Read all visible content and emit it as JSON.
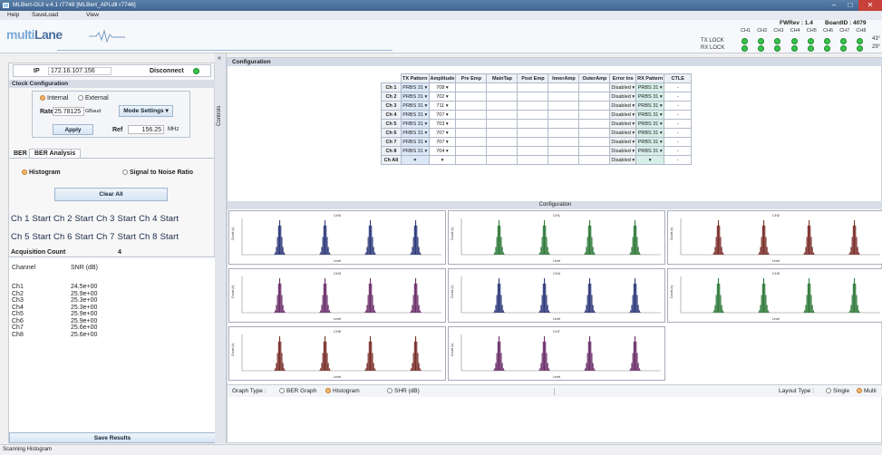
{
  "window": {
    "title": "MLBert-GUI v.4.1 r7748 [MLBert_API.dll r7746]"
  },
  "menu": [
    "Help",
    "SaveLoad",
    "View"
  ],
  "header": {
    "logo_main": "multi",
    "logo_accent": "Lane",
    "fwrev": "FWRev : 1.4",
    "boardid": "BoardID : 4079",
    "tx_lock": "TX LOCK",
    "rx_lock": "RX LOCK",
    "channels": [
      "CH1",
      "CH2",
      "CH3",
      "CH4",
      "CH5",
      "CH6",
      "CH7",
      "CH8"
    ],
    "side_values": [
      "43°",
      "29°"
    ]
  },
  "connection": {
    "ip_label": "IP",
    "ip_value": "172.16.107.156",
    "disconnect_label": "Disconnect"
  },
  "clock": {
    "title": "Clock Configuration",
    "internal": "Internal",
    "external": "External",
    "rate_label": "Rate",
    "rate_value": "25.78125",
    "unit": "GBaud",
    "mode_btn": "Mode Settings",
    "apply": "Apply",
    "ref_label": "Ref",
    "ref_value": "156.25",
    "ref_unit": "MHz"
  },
  "tabs": [
    "BER",
    "BER Analysis"
  ],
  "analysis": {
    "histogram": "Histogram",
    "snr": "Signal to Noise Ratio",
    "clear_all": "Clear All"
  },
  "starts": [
    [
      "Ch 1",
      "Start"
    ],
    [
      "Ch 2",
      "Start"
    ],
    [
      "Ch 3",
      "Start"
    ],
    [
      "Ch 4",
      "Start"
    ],
    [
      "Ch 5",
      "Start"
    ],
    [
      "Ch 6",
      "Start"
    ],
    [
      "Ch 7",
      "Start"
    ],
    [
      "Ch 8",
      "Start"
    ]
  ],
  "acq": {
    "label": "Acquisition Count",
    "value": "4",
    "channel_hdr": "Channel",
    "snr_hdr": "SNR (dB)"
  },
  "snr_rows": [
    [
      "Ch1",
      "24.5e+00"
    ],
    [
      "Ch2",
      "25.9e+00"
    ],
    [
      "Ch3",
      "25.3e+00"
    ],
    [
      "Ch4",
      "25.3e+00"
    ],
    [
      "Ch5",
      "25.9e+00"
    ],
    [
      "Ch6",
      "25.9e+00"
    ],
    [
      "Ch7",
      "25.6e+00"
    ],
    [
      "Ch8",
      "25.6e+00"
    ]
  ],
  "save_results": "Save Results",
  "controls_label": "Controls",
  "config": {
    "title": "Configuration",
    "columns": [
      "TX Pattern",
      "Amplitude",
      "Pre Emp",
      "MainTap",
      "Post Emp",
      "InnerAmp",
      "OuterAmp",
      "Error Ins",
      "RX Pattern",
      "CTLE"
    ],
    "rows": [
      {
        "ch": "Ch 1",
        "tx": "PRBS 31",
        "amp": "708",
        "err": "Disabled",
        "rx": "PRBS 31",
        "ctle": "-"
      },
      {
        "ch": "Ch 2",
        "tx": "PRBS 31",
        "amp": "702",
        "err": "Disabled",
        "rx": "PRBS 31",
        "ctle": "-"
      },
      {
        "ch": "Ch 3",
        "tx": "PRBS 31",
        "amp": "711",
        "err": "Disabled",
        "rx": "PRBS 31",
        "ctle": "-"
      },
      {
        "ch": "Ch 4",
        "tx": "PRBS 31",
        "amp": "707",
        "err": "Disabled",
        "rx": "PRBS 31",
        "ctle": "-"
      },
      {
        "ch": "Ch 5",
        "tx": "PRBS 31",
        "amp": "703",
        "err": "Disabled",
        "rx": "PRBS 31",
        "ctle": "-"
      },
      {
        "ch": "Ch 6",
        "tx": "PRBS 31",
        "amp": "707",
        "err": "Disabled",
        "rx": "PRBS 31",
        "ctle": "-"
      },
      {
        "ch": "Ch 7",
        "tx": "PRBS 31",
        "amp": "707",
        "err": "Disabled",
        "rx": "PRBS 31",
        "ctle": "-"
      },
      {
        "ch": "Ch 8",
        "tx": "PRBS 31",
        "amp": "704",
        "err": "Disabled",
        "rx": "PRBS 31",
        "ctle": "-"
      },
      {
        "ch": "Ch All",
        "tx": "",
        "amp": "",
        "err": "Disabled",
        "rx": "",
        "ctle": "-"
      }
    ]
  },
  "plots": {
    "title": "Configuration",
    "items": [
      {
        "name": "CH0",
        "color": "#2e3a7a"
      },
      {
        "name": "CH1",
        "color": "#2f7a3a"
      },
      {
        "name": "CH2",
        "color": "#7a2f2a"
      },
      {
        "name": "CH3",
        "color": "#6a2f6a"
      },
      {
        "name": "CH4",
        "color": "#2e3a7a"
      },
      {
        "name": "CH5",
        "color": "#2f7a3a"
      },
      {
        "name": "CH6",
        "color": "#7a2f2a"
      },
      {
        "name": "CH7",
        "color": "#6a2f6a"
      }
    ],
    "xlabel": "Level",
    "ylabel": "Count (k)"
  },
  "graph": {
    "type_label": "Graph Type :",
    "ber_graph": "BER Graph",
    "histogram": "Histogram",
    "snr": "SHR (dB)",
    "layout_label": "Layout Type :",
    "single": "Single",
    "multi": "Multi"
  },
  "status": "Scanning Histogram",
  "colors": {
    "led": "#37c34a",
    "accent": "#4a6fa0"
  }
}
